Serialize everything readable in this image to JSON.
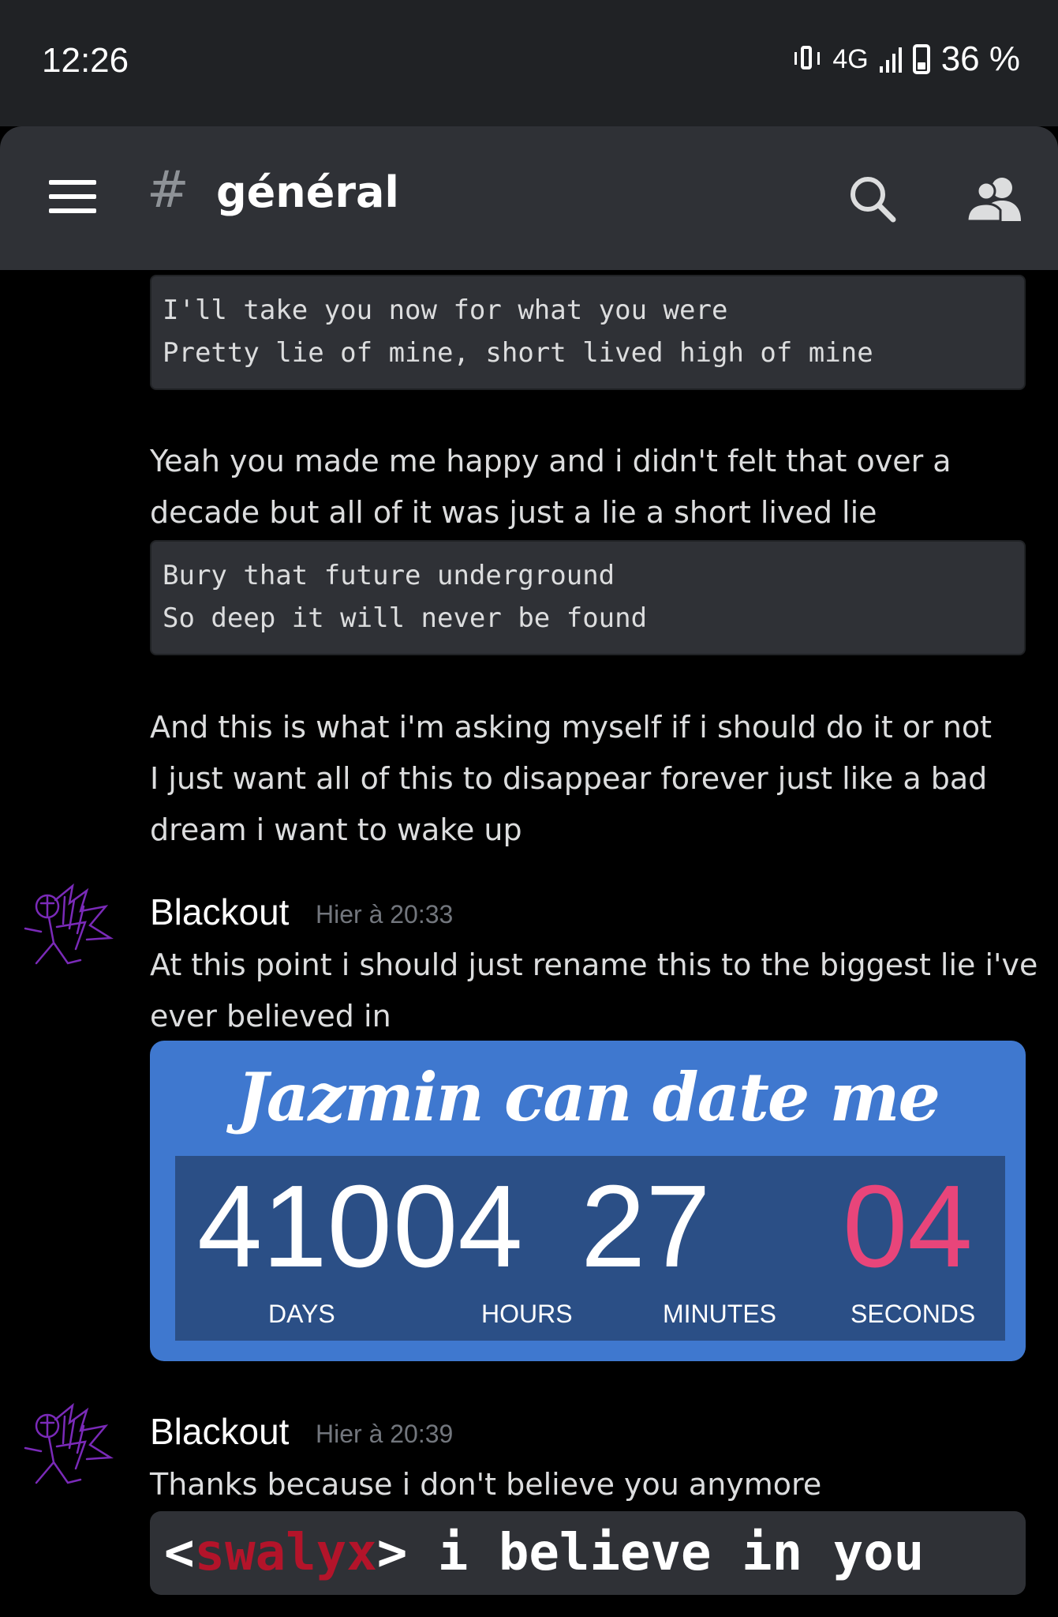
{
  "status_bar": {
    "time": "12:26",
    "network": "4G",
    "battery": "36 %"
  },
  "header": {
    "hash": "#",
    "channel": "général"
  },
  "messages": {
    "code1": [
      "I'll take you now for what you were",
      "Pretty lie of mine, short lived high of mine"
    ],
    "text1": [
      "Yeah you made me happy and i didn't felt that over a",
      "decade but all of it was just a lie a short lived lie"
    ],
    "code2": [
      "Bury that future underground",
      "So deep it will never be found"
    ],
    "text2": [
      "And this is what i'm asking myself if i should do it or not",
      "I just want all of this to disappear forever just like a bad",
      "dream i want to wake up"
    ],
    "msg1": {
      "username": "Blackout",
      "timestamp": "Hier à 20:33",
      "text": [
        "At this point i should just rename this to the biggest lie i've",
        "ever believed in"
      ]
    },
    "countdown": {
      "title": "Jazmin can date me",
      "days": "410",
      "hours": "04",
      "minutes": "27",
      "seconds": "04",
      "days_label": "DAYS",
      "hours_label": "HOURS",
      "minutes_label": "MINUTES",
      "seconds_label": "SECONDS",
      "accent_color": "#e8457a"
    },
    "msg2": {
      "username": "Blackout",
      "timestamp": "Hier à 20:39",
      "text": "Thanks because i don't believe you anymore",
      "term_open": "<",
      "term_user": "swalyx",
      "term_close": ">",
      "term_text": " i believe in you"
    }
  }
}
